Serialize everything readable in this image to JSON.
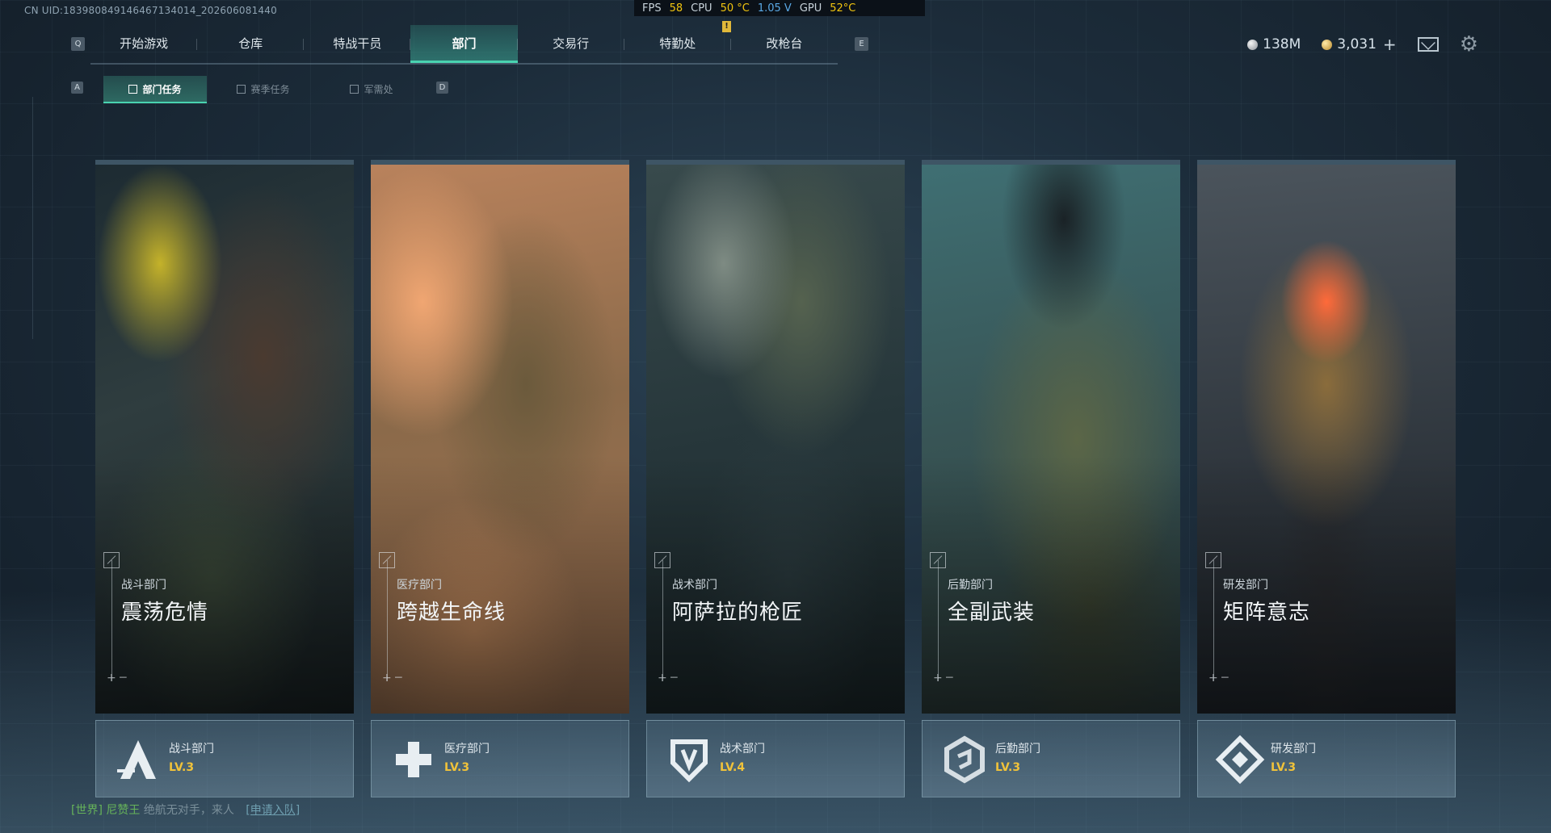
{
  "uid_text": "CN UID:1839808491464671340​14_202606081440",
  "perf": {
    "fps_label": "FPS",
    "fps_value": "58",
    "cpu_label": "CPU",
    "cpu_value": "50 °C",
    "volt_value": "1.05 V",
    "gpu_label": "GPU",
    "gpu_value": "52°C",
    "marker": "!"
  },
  "key_hints": {
    "left": "Q",
    "right": "E",
    "sub_left": "A",
    "sub_right": "D"
  },
  "main_nav": [
    {
      "label": "开始游戏"
    },
    {
      "label": "仓库"
    },
    {
      "label": "特战干员"
    },
    {
      "label": "部门"
    },
    {
      "label": "交易行"
    },
    {
      "label": "特勤处"
    },
    {
      "label": "改枪台"
    }
  ],
  "sub_nav": [
    {
      "label": "部门任务"
    },
    {
      "label": "赛季任务"
    },
    {
      "label": "军需处"
    }
  ],
  "currency": {
    "silver": "138M",
    "gold": "3,031",
    "plus": "+"
  },
  "cards": [
    {
      "dept": "战斗部门",
      "title": "震荡危情"
    },
    {
      "dept": "医疗部门",
      "title": "跨越生命线"
    },
    {
      "dept": "战术部门",
      "title": "阿萨拉的枪匠"
    },
    {
      "dept": "后勤部门",
      "title": "全副武装"
    },
    {
      "dept": "研发部门",
      "title": "矩阵意志"
    }
  ],
  "departments": [
    {
      "name": "战斗部门",
      "level": "LV.3",
      "icon": "combat-a-icon"
    },
    {
      "name": "医疗部门",
      "level": "LV.3",
      "icon": "medical-cross-icon"
    },
    {
      "name": "战术部门",
      "level": "LV.4",
      "icon": "tactical-shield-icon"
    },
    {
      "name": "后勤部门",
      "level": "LV.3",
      "icon": "logistics-hex-icon"
    },
    {
      "name": "研发部门",
      "level": "LV.3",
      "icon": "research-diamond-icon"
    }
  ],
  "chat": {
    "channel": "[世界]",
    "user": "尼赞王",
    "message": "绝航无对手，来人",
    "link": "[申请入队]"
  },
  "colors": {
    "accent": "#49d3b0",
    "level": "#f0c23a",
    "chat": "#66b35a"
  }
}
